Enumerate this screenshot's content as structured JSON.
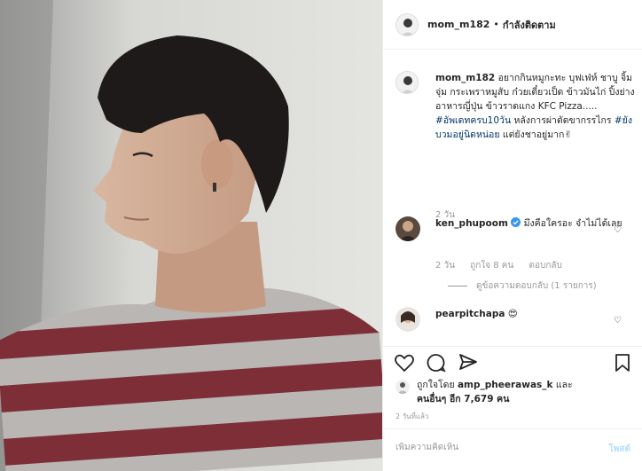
{
  "post": {
    "username": "mom_m182",
    "follow_status": "กำลังติดตาม",
    "separator": "•"
  },
  "caption": {
    "username": "mom_m182",
    "text_1": "อยากกินหมูกะทะ บุฟเฟ่ห์ ชาบู จิ้มจุ่ม กระเพราหมูสับ ก๋วยเตี๋ยวเป็ด ข้าวมันไก่ ปิ้งย่าง อาหารญี่ปุ่น ข้าวราดแกง KFC Pizza.....",
    "hashtag_1": "#อัพเดทครบ10วัน",
    "text_2": "หลังการผ่าตัดขากรรไกร",
    "hashtag_2": "#ยังบวมอยู่นิดหน่อย",
    "text_3": "แต่ยังชาอยู่มาก✌",
    "time": "2 วัน"
  },
  "comments": [
    {
      "username": "ken_phupoom",
      "verified": true,
      "text": "มึงคือใครอะ จำไม่ได้เลย",
      "time": "2 วัน",
      "likes": "ถูกใจ 8 คน",
      "reply": "ตอบกลับ",
      "view_replies": "ดูข้อความตอบกลับ (1 รายการ)"
    },
    {
      "username": "pearpitchapa",
      "text": "😍"
    }
  ],
  "likes": {
    "prefix": "ถูกใจโดย",
    "user": "amp_pheerawas_k",
    "and": "และ",
    "others": "คนอื่นๆ อีก 7,679 คน"
  },
  "time_ago": "2 วันที่แล้ว",
  "add_comment": {
    "placeholder": "เพิ่มความคิดเห็น",
    "post_label": "โพสต์"
  },
  "icons": {
    "like": "heart-icon",
    "comment": "comment-icon",
    "share": "share-icon",
    "save": "bookmark-icon",
    "verified": "verified-badge-icon"
  },
  "colors": {
    "link": "#003569",
    "muted": "#999999",
    "verified": "#3897f0",
    "post_disabled": "#b2dffc"
  }
}
